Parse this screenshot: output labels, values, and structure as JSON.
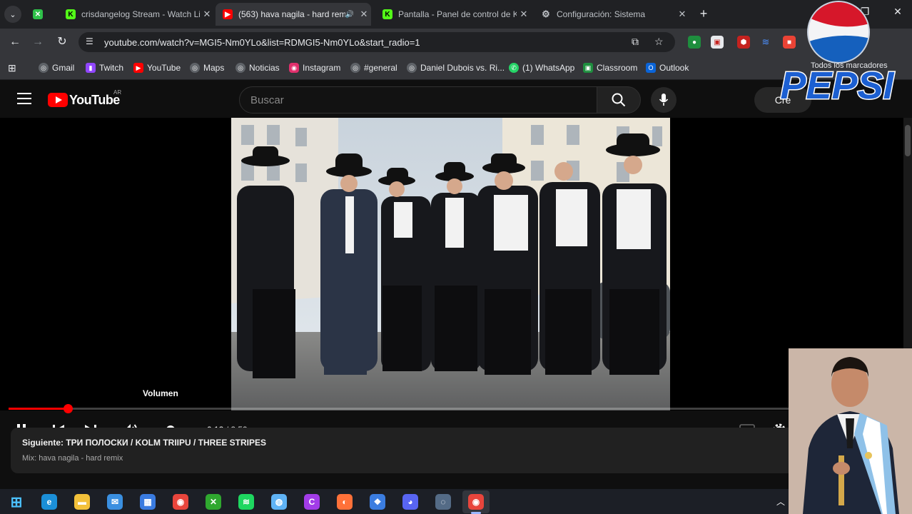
{
  "browser": {
    "tabs": [
      {
        "title": "",
        "favicon": "xbox-icon",
        "color": "#2fc14a"
      },
      {
        "title": "crisdangelog Stream - Watch Li",
        "favicon": "kick-icon",
        "color": "#53fc18"
      },
      {
        "title": "(563) hava nagila - hard rem",
        "favicon": "youtube-icon",
        "color": "#ff0000",
        "active": true,
        "audio": true
      },
      {
        "title": "Pantalla - Panel de control de K",
        "favicon": "kick-icon",
        "color": "#53fc18"
      },
      {
        "title": "Configuración: Sistema",
        "favicon": "gear-icon",
        "color": "#9aa0a6"
      }
    ],
    "url": "youtube.com/watch?v=MGI5-Nm0YLo&list=RDMGI5-Nm0YLo&start_radio=1",
    "bookmarks": [
      {
        "label": "Gmail",
        "icon": "globe-icon",
        "color": "#5f6368"
      },
      {
        "label": "Twitch",
        "icon": "twitch-icon",
        "color": "#9146ff"
      },
      {
        "label": "YouTube",
        "icon": "youtube-icon",
        "color": "#ff0000"
      },
      {
        "label": "Maps",
        "icon": "globe-icon",
        "color": "#5f6368"
      },
      {
        "label": "Noticias",
        "icon": "globe-icon",
        "color": "#5f6368"
      },
      {
        "label": "Instagram",
        "icon": "instagram-icon",
        "color": "#e1306c"
      },
      {
        "label": "#general",
        "icon": "globe-icon",
        "color": "#5f6368"
      },
      {
        "label": "Daniel Dubois vs. Ri...",
        "icon": "globe-icon",
        "color": "#5f6368"
      },
      {
        "label": "(1) WhatsApp",
        "icon": "whatsapp-icon",
        "color": "#25d366"
      },
      {
        "label": "Classroom",
        "icon": "classroom-icon",
        "color": "#1e8e3e"
      },
      {
        "label": "Outlook",
        "icon": "outlook-icon",
        "color": "#0a64d8"
      }
    ],
    "all_bookmarks": "Todos los marcadores"
  },
  "youtube": {
    "logo_text": "YouTube",
    "country_code": "AR",
    "search_placeholder": "Buscar",
    "create_label": "Cre",
    "player": {
      "tooltip": "Volumen",
      "current_time": "0:12",
      "total_time": "2:59",
      "progress_fraction": 0.067,
      "volume_fraction": 0.85
    },
    "next_up": {
      "title": "Siguiente: ТРИ ПОЛОСКИ / KOLM TRIIPU / THREE STRIPES",
      "subtitle": "Mix: hava nagila - hard remix"
    }
  },
  "overlay": {
    "brand_text": "PEPSI"
  },
  "taskbar": {
    "apps": [
      {
        "name": "windows-start-icon",
        "color": "#4cc2ff",
        "glyph": "⊞"
      },
      {
        "name": "edge-icon",
        "color": "#1b8fd8",
        "glyph": "e"
      },
      {
        "name": "file-explorer-icon",
        "color": "#f3c13a",
        "glyph": "▬"
      },
      {
        "name": "mail-icon",
        "color": "#3a8fe0",
        "glyph": "✉"
      },
      {
        "name": "store-icon",
        "color": "#3a7be0",
        "glyph": "▦"
      },
      {
        "name": "chrome-icon",
        "color": "#e8453c",
        "glyph": "◉"
      },
      {
        "name": "xbox-icon",
        "color": "#2fa82f",
        "glyph": "✕"
      },
      {
        "name": "spotify-icon",
        "color": "#1ed760",
        "glyph": "≋"
      },
      {
        "name": "globe-app-icon",
        "color": "#5fb3f5",
        "glyph": "◍"
      },
      {
        "name": "canva-icon",
        "color": "#a23ce8",
        "glyph": "C"
      },
      {
        "name": "firefox-icon",
        "color": "#ff7139",
        "glyph": "◐"
      },
      {
        "name": "vscode-icon",
        "color": "#3b7de0",
        "glyph": "❖"
      },
      {
        "name": "discord-icon",
        "color": "#5865f2",
        "glyph": "◕"
      },
      {
        "name": "steam-icon",
        "color": "#546b86",
        "glyph": "◌"
      },
      {
        "name": "chrome-active-icon",
        "color": "#e8453c",
        "glyph": "◉"
      }
    ]
  }
}
